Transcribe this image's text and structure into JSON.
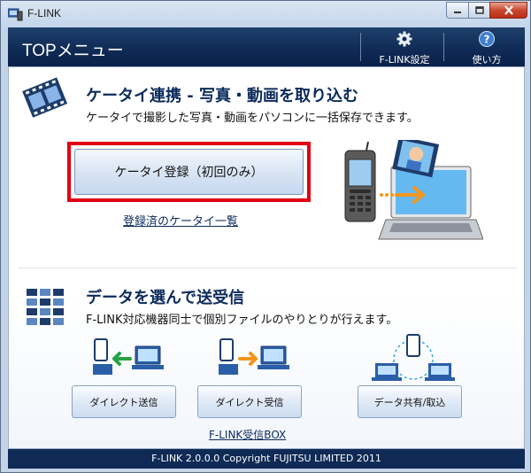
{
  "window": {
    "title": "F-LINK"
  },
  "header": {
    "title": "TOPメニュー",
    "settings_label": "F-LINK設定",
    "help_label": "使い方"
  },
  "section1": {
    "title": "ケータイ連携 - 写真・動画を取り込む",
    "description": "ケータイで撮影した写真・動画をパソコンに一括保存できます。",
    "register_button": "ケータイ登録（初回のみ）",
    "registered_link": "登録済のケータイ一覧"
  },
  "section2": {
    "title": "データを選んで送受信",
    "description": "F-LINK対応機器同士で個別ファイルのやりとりが行えます。",
    "buttons": [
      "ダイレクト送信",
      "ダイレクト受信",
      "データ共有/取込"
    ],
    "inbox_link": "F-LINK受信BOX"
  },
  "footer": {
    "text": "F-LINK  2.0.0.0  Copyright FUJITSU LIMITED 2011"
  },
  "colors": {
    "header_bg": "#0e2a55",
    "accent_highlight": "#e00012",
    "title_text": "#0b2a5c",
    "send_arrow": "#27a244",
    "receive_arrow": "#f2961c"
  }
}
